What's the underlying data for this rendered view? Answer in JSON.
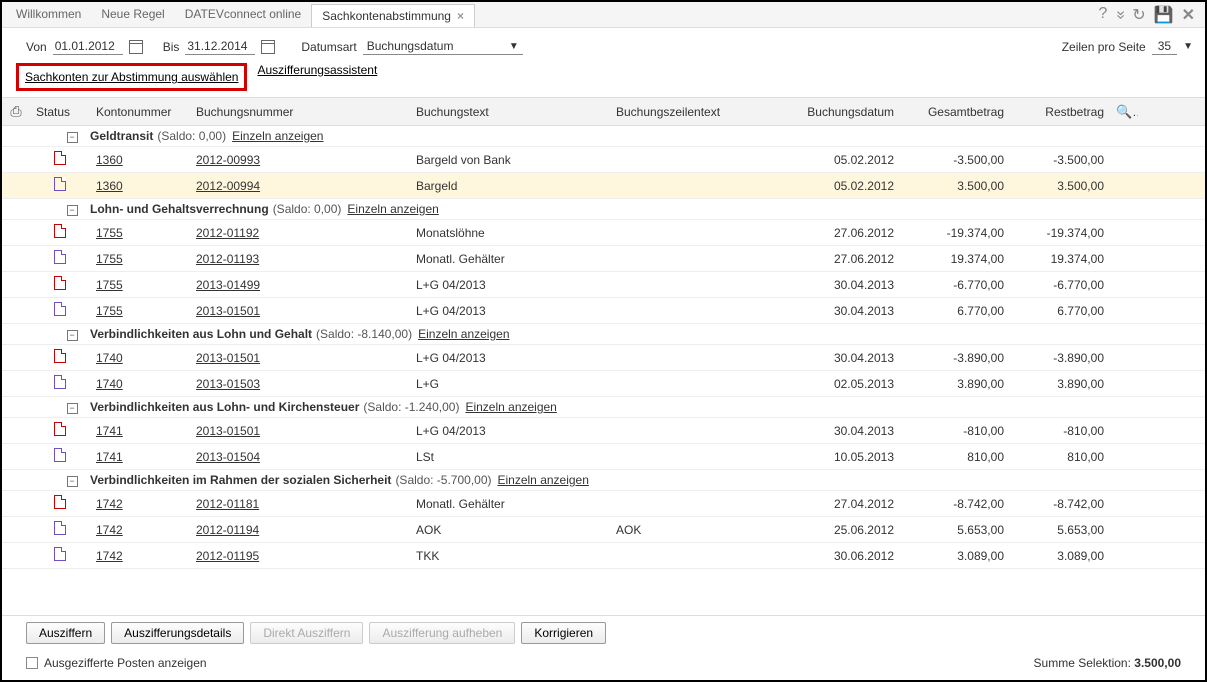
{
  "tabs": [
    "Willkommen",
    "Neue Regel",
    "DATEVconnect online",
    "Sachkontenabstimmung"
  ],
  "activeTab": 3,
  "filters": {
    "vonLabel": "Von",
    "vonValue": "01.01.2012",
    "bisLabel": "Bis",
    "bisValue": "31.12.2014",
    "datumsartLabel": "Datumsart",
    "datumsartValue": "Buchungsdatum",
    "rowsLabel": "Zeilen pro Seite",
    "rowsValue": "35"
  },
  "links": {
    "selectAccounts": "Sachkonten zur Abstimmung auswählen",
    "assistant": "Auszifferungsassistent"
  },
  "columns": {
    "status": "Status",
    "konto": "Kontonummer",
    "buchnr": "Buchungsnummer",
    "buchtext": "Buchungstext",
    "zeilentext": "Buchungszeilentext",
    "datum": "Buchungsdatum",
    "betrag": "Gesamtbetrag",
    "rest": "Restbetrag"
  },
  "einzelnAnzeigen": "Einzeln anzeigen",
  "groups": [
    {
      "title": "Geldtransit",
      "saldo": "(Saldo: 0,00)",
      "rows": [
        {
          "icon": "red",
          "konto": "1360",
          "nr": "2012-00993",
          "text": "Bargeld von Bank",
          "ztext": "",
          "datum": "05.02.2012",
          "betrag": "-3.500,00",
          "rest": "-3.500,00",
          "hl": false
        },
        {
          "icon": "purple",
          "konto": "1360",
          "nr": "2012-00994",
          "text": "Bargeld",
          "ztext": "",
          "datum": "05.02.2012",
          "betrag": "3.500,00",
          "rest": "3.500,00",
          "hl": true
        }
      ]
    },
    {
      "title": "Lohn- und Gehaltsverrechnung",
      "saldo": "(Saldo: 0,00)",
      "rows": [
        {
          "icon": "red",
          "konto": "1755",
          "nr": "2012-01192",
          "text": "Monatslöhne",
          "ztext": "",
          "datum": "27.06.2012",
          "betrag": "-19.374,00",
          "rest": "-19.374,00",
          "hl": false
        },
        {
          "icon": "purple",
          "konto": "1755",
          "nr": "2012-01193",
          "text": "Monatl. Gehälter",
          "ztext": "",
          "datum": "27.06.2012",
          "betrag": "19.374,00",
          "rest": "19.374,00",
          "hl": false
        },
        {
          "icon": "red",
          "konto": "1755",
          "nr": "2013-01499",
          "text": "L+G 04/2013",
          "ztext": "",
          "datum": "30.04.2013",
          "betrag": "-6.770,00",
          "rest": "-6.770,00",
          "hl": false
        },
        {
          "icon": "purple",
          "konto": "1755",
          "nr": "2013-01501",
          "text": "L+G 04/2013",
          "ztext": "",
          "datum": "30.04.2013",
          "betrag": "6.770,00",
          "rest": "6.770,00",
          "hl": false
        }
      ]
    },
    {
      "title": "Verbindlichkeiten aus Lohn und Gehalt",
      "saldo": "(Saldo: -8.140,00)",
      "rows": [
        {
          "icon": "red",
          "konto": "1740",
          "nr": "2013-01501",
          "text": "L+G 04/2013",
          "ztext": "",
          "datum": "30.04.2013",
          "betrag": "-3.890,00",
          "rest": "-3.890,00",
          "hl": false
        },
        {
          "icon": "purple",
          "konto": "1740",
          "nr": "2013-01503",
          "text": "L+G",
          "ztext": "",
          "datum": "02.05.2013",
          "betrag": "3.890,00",
          "rest": "3.890,00",
          "hl": false
        }
      ]
    },
    {
      "title": "Verbindlichkeiten aus Lohn- und Kirchensteuer",
      "saldo": "(Saldo: -1.240,00)",
      "rows": [
        {
          "icon": "red",
          "konto": "1741",
          "nr": "2013-01501",
          "text": "L+G 04/2013",
          "ztext": "",
          "datum": "30.04.2013",
          "betrag": "-810,00",
          "rest": "-810,00",
          "hl": false
        },
        {
          "icon": "purple",
          "konto": "1741",
          "nr": "2013-01504",
          "text": "LSt",
          "ztext": "",
          "datum": "10.05.2013",
          "betrag": "810,00",
          "rest": "810,00",
          "hl": false
        }
      ]
    },
    {
      "title": "Verbindlichkeiten im Rahmen der sozialen Sicherheit",
      "saldo": "(Saldo: -5.700,00)",
      "rows": [
        {
          "icon": "red",
          "konto": "1742",
          "nr": "2012-01181",
          "text": "Monatl. Gehälter",
          "ztext": "",
          "datum": "27.04.2012",
          "betrag": "-8.742,00",
          "rest": "-8.742,00",
          "hl": false
        },
        {
          "icon": "purple",
          "konto": "1742",
          "nr": "2012-01194",
          "text": "AOK",
          "ztext": "AOK",
          "datum": "25.06.2012",
          "betrag": "5.653,00",
          "rest": "5.653,00",
          "hl": false
        },
        {
          "icon": "purple",
          "konto": "1742",
          "nr": "2012-01195",
          "text": "TKK",
          "ztext": "",
          "datum": "30.06.2012",
          "betrag": "3.089,00",
          "rest": "3.089,00",
          "hl": false
        }
      ]
    }
  ],
  "buttons": {
    "ausziffern": "Ausziffern",
    "details": "Auszifferungsdetails",
    "direkt": "Direkt Ausziffern",
    "aufheben": "Auszifferung aufheben",
    "korrigieren": "Korrigieren"
  },
  "footer": {
    "checkbox": "Ausgezifferte Posten anzeigen",
    "sumLabel": "Summe Selektion:",
    "sumValue": "3.500,00"
  }
}
